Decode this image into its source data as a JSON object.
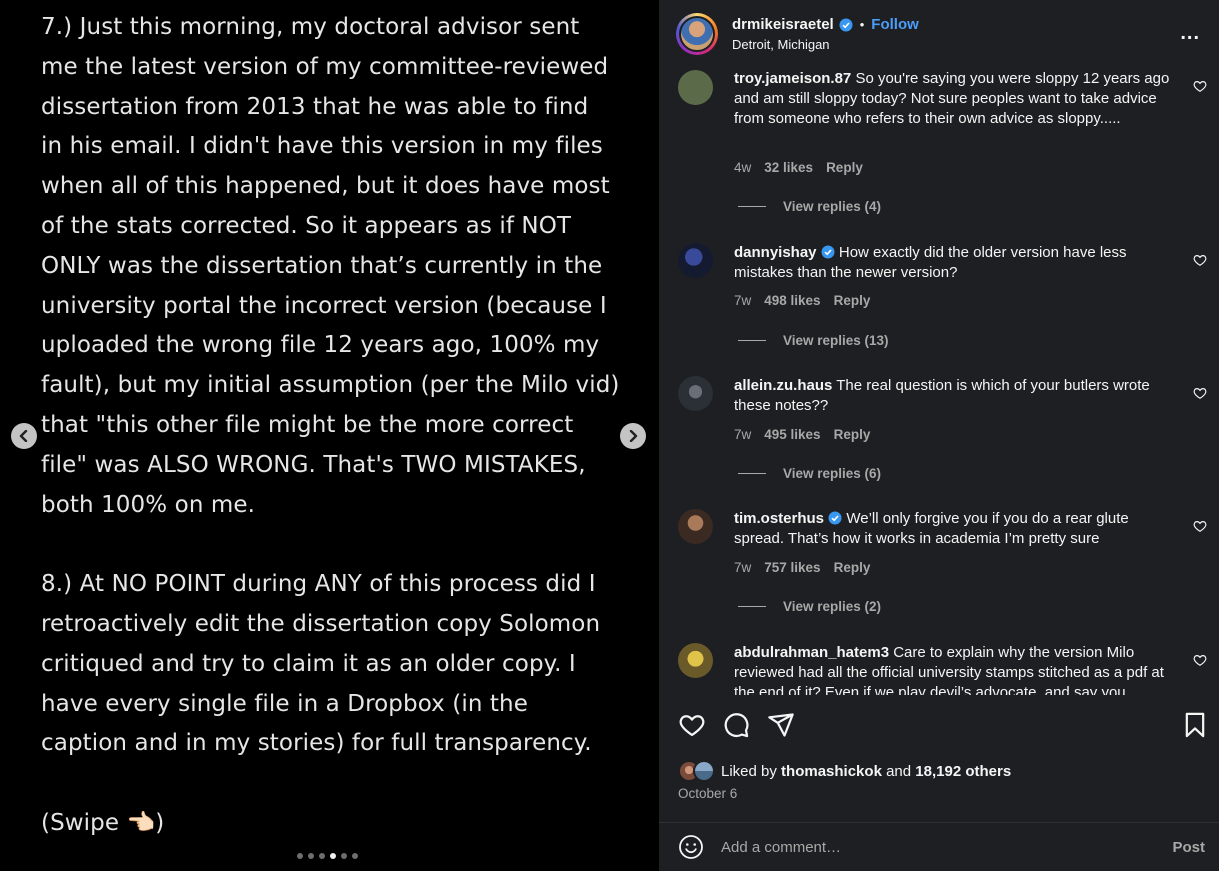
{
  "post_text": {
    "para1": [
      "7.) Just this morning, my doctoral advisor sent",
      "me the latest version of my committee-reviewed",
      "dissertation from 2013 that he was able to find",
      "in his email. I didn't have this version in my files",
      "when all of this happened, but it does have most",
      "of the stats corrected. So it appears as if NOT",
      "ONLY was the dissertation that’s currently in the",
      "university portal the incorrect version (because I",
      "uploaded the wrong file 12 years ago, 100% my",
      "fault), but my initial assumption (per the Milo vid)",
      "that \"this other file might be the more correct",
      "file\" was ALSO WRONG. That's TWO MISTAKES,",
      "both 100% on me."
    ],
    "para2": [
      "8.) At NO POINT during ANY of this process did I",
      "retroactively edit the dissertation copy Solomon",
      "critiqued and try to claim it as an older copy. I",
      "have every single file in a Dropbox (in the",
      "caption and in my stories) for full transparency."
    ],
    "para3": "(Swipe 👈🏻)"
  },
  "carousel": {
    "slide_count": 6,
    "active_index": 3
  },
  "header": {
    "username": "drmikeisraetel",
    "separator": "•",
    "follow_label": "Follow",
    "location": "Detroit, Michigan",
    "more_label": "..."
  },
  "comments": [
    {
      "username": "troy.jameison.87",
      "verified": false,
      "text": "So you're saying you were sloppy 12 years ago and am still sloppy today? Not sure peoples want to take advice from someone who refers to their own advice as sloppy.....",
      "age": "4w",
      "likes": "32 likes",
      "reply_label": "Reply",
      "view_replies": "View replies (4)",
      "avatar_color": "#5b6b4a"
    },
    {
      "username": "dannyishay",
      "verified": true,
      "text": "How exactly did the older version have less mistakes than the newer version?",
      "age": "7w",
      "likes": "498 likes",
      "reply_label": "Reply",
      "view_replies": "View replies (13)",
      "avatar_color": "#1c2340"
    },
    {
      "username": "allein.zu.haus",
      "verified": false,
      "text": "The real question is which of your butlers wrote these notes??",
      "age": "7w",
      "likes": "495 likes",
      "reply_label": "Reply",
      "view_replies": "View replies (6)",
      "avatar_color": "#3a3f48"
    },
    {
      "username": "tim.osterhus",
      "verified": true,
      "text": "We’ll only forgive you if you do a rear glute spread. That’s how it works in academia I’m pretty sure",
      "age": "7w",
      "likes": "757 likes",
      "reply_label": "Reply",
      "view_replies": "View replies (2)",
      "avatar_color": "#6b4a36"
    },
    {
      "username": "abdulrahman_hatem3",
      "verified": false,
      "text": "Care to explain why the version Milo reviewed had all the official university stamps stitched as a pdf at the end of it? Even if we play devil’s advocate, and say you",
      "avatar_color": "#b8a23a"
    }
  ],
  "likes_summary": {
    "prefix": "Liked by",
    "user": "thomashickok",
    "middle": "and",
    "others": "18,192 others"
  },
  "post_date": "October 6",
  "add_comment": {
    "placeholder": "Add a comment…",
    "post_label": "Post"
  },
  "colors": {
    "accent": "#4a9df8",
    "panel_bg": "#1e1f22",
    "verified": "#3897f0"
  }
}
